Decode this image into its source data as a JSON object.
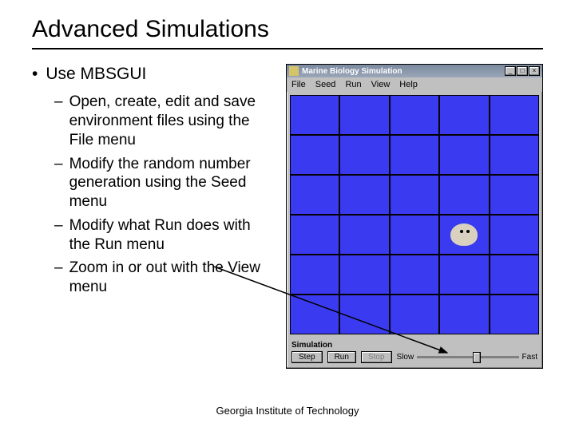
{
  "title": "Advanced Simulations",
  "bullets": {
    "main": "Use MBSGUI",
    "subs": [
      "Open, create, edit and save environment files using the File menu",
      "Modify the random number generation using the Seed menu",
      "Modify what Run does with the Run menu",
      "Zoom in or out with the View menu"
    ]
  },
  "app": {
    "window_title": "Marine Biology Simulation",
    "menus": [
      "File",
      "Seed",
      "Run",
      "View",
      "Help"
    ],
    "panel_label": "Simulation",
    "buttons": {
      "step": "Step",
      "run": "Run",
      "stop": "Stop"
    },
    "slider": {
      "slow": "Slow",
      "fast": "Fast"
    }
  },
  "footer": "Georgia Institute of Technology"
}
